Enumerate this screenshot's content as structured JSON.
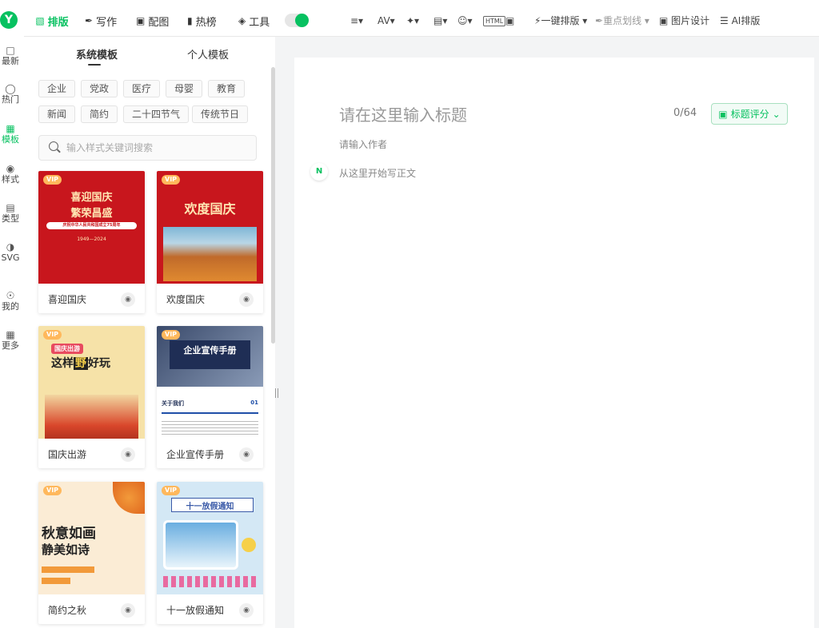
{
  "rail": {
    "logo": "Y",
    "items": [
      {
        "label": "最新",
        "icon": "chat-icon"
      },
      {
        "label": "热门",
        "icon": "fire-icon"
      },
      {
        "label": "模板",
        "icon": "template-icon"
      },
      {
        "label": "样式",
        "icon": "style-icon"
      },
      {
        "label": "类型",
        "icon": "type-icon"
      },
      {
        "label": "SVG",
        "icon": "svg-icon"
      },
      {
        "label": "我的",
        "icon": "user-icon"
      },
      {
        "label": "更多",
        "icon": "grid-icon"
      }
    ]
  },
  "topbar": {
    "tabs": [
      {
        "label": "排版",
        "icon": "layout-icon"
      },
      {
        "label": "写作",
        "icon": "pen-icon"
      },
      {
        "label": "配图",
        "icon": "image-icon"
      },
      {
        "label": "热榜",
        "icon": "bookmark-icon"
      },
      {
        "label": "工具",
        "icon": "cube-icon"
      }
    ],
    "tools": {
      "one_click": "一键排版",
      "highlight": "重点划线",
      "image_design": "图片设计",
      "ai_layout": "AI排版",
      "html": "HTML"
    }
  },
  "panel": {
    "tabs": [
      "系统模板",
      "个人模板"
    ],
    "chips_row1": [
      "企业",
      "党政",
      "医疗",
      "母婴",
      "教育"
    ],
    "chips_row2": [
      "新闻",
      "简约",
      "二十四节气",
      "传统节日"
    ],
    "search_placeholder": "输入样式关键词搜索",
    "vip": "VIP",
    "cards": [
      {
        "name": "喜迎国庆",
        "thumb": {
          "l1": "喜迎国庆",
          "l2": "繁荣昌盛",
          "l3": "庆祝中华人民共和国成立75周年",
          "l4": "1949—2024"
        }
      },
      {
        "name": "欢度国庆",
        "thumb": {
          "l1": "欢度国庆"
        }
      },
      {
        "name": "国庆出游",
        "thumb": {
          "l1": "国庆出游",
          "l2": "这样",
          "l3": "野",
          "l4": "好玩"
        }
      },
      {
        "name": "企业宣传手册",
        "thumb": {
          "l1": "企业宣传手册",
          "l2": "关于我们",
          "l3": "01"
        }
      },
      {
        "name": "简约之秋",
        "thumb": {
          "l1": "秋意如画",
          "l2": "静美如诗"
        }
      },
      {
        "name": "十一放假通知",
        "thumb": {
          "l1": "十一放假通知"
        }
      }
    ]
  },
  "editor": {
    "title_placeholder": "请在这里输入标题",
    "counter": "0/64",
    "score_button": "标题评分",
    "author_placeholder": "请输入作者",
    "body_placeholder": "从这里开始写正文"
  },
  "colors": {
    "accent": "#07c160"
  }
}
